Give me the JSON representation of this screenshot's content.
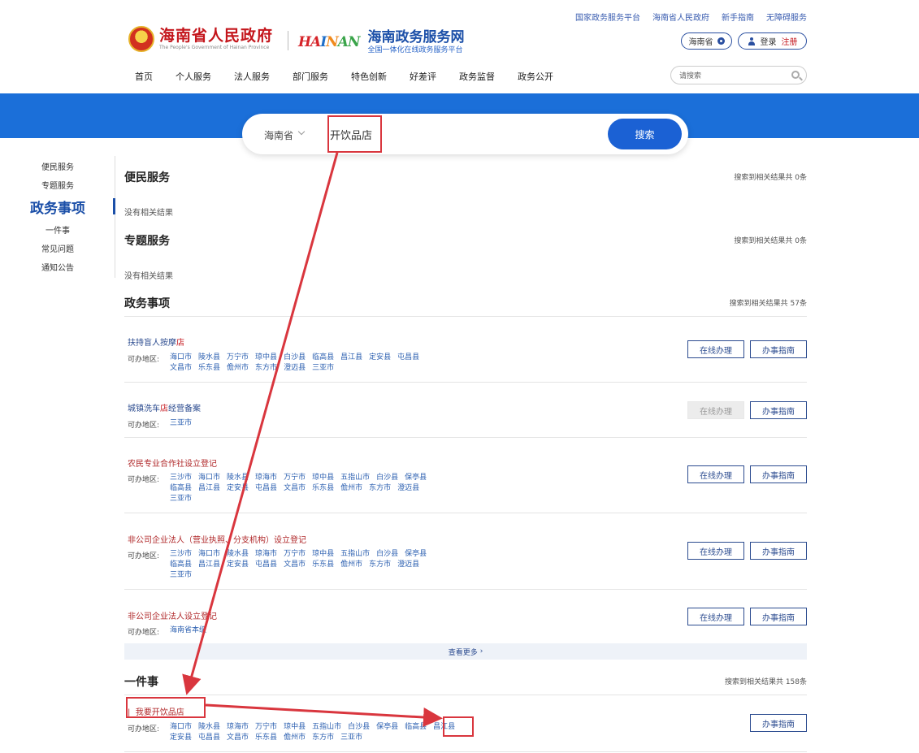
{
  "top_links": [
    "国家政务服务平台",
    "海南省人民政府",
    "新手指南",
    "无障碍服务"
  ],
  "logo_gov": {
    "zh": "海南省人民政府",
    "en": "The People's Government of Hainan Province"
  },
  "logo_service": {
    "brand": "HAINAN",
    "zh": "海南政务服务网",
    "sub": "全国一体化在线政务服务平台"
  },
  "region_selector": "海南省",
  "login": {
    "login_label": "登录",
    "register_label": "注册"
  },
  "nav": [
    "首页",
    "个人服务",
    "法人服务",
    "部门服务",
    "特色创新",
    "好差评",
    "政务监督",
    "政务公开"
  ],
  "site_search_placeholder": "请搜索",
  "main_search": {
    "region": "海南省",
    "query": "开饮品店",
    "button": "搜索"
  },
  "sidenav": [
    "便民服务",
    "专题服务",
    "政务事项",
    "一件事",
    "常见问题",
    "通知公告"
  ],
  "sections": {
    "bianmin": {
      "title": "便民服务",
      "count": "搜索到相关结果共 0条",
      "empty": "没有相关结果"
    },
    "zhuanti": {
      "title": "专题服务",
      "count": "搜索到相关结果共 0条",
      "empty": "没有相关结果"
    },
    "zhengwu": {
      "title": "政务事项",
      "count": "搜索到相关结果共 57条"
    },
    "yijianshi": {
      "title": "一件事",
      "count": "搜索到相关结果共 158条"
    }
  },
  "area_label": "可办地区:",
  "online_label": "在线办理",
  "guide_label": "办事指南",
  "more_label": "查看更多",
  "items": [
    {
      "name_pre": "扶持盲人按摩",
      "name_hl": "店",
      "name_post": "",
      "areas": [
        "海口市",
        "陵水县",
        "万宁市",
        "琼中县",
        "白沙县",
        "临高县",
        "昌江县",
        "定安县",
        "屯昌县",
        "文昌市",
        "乐东县",
        "儋州市",
        "东方市",
        "澄迈县",
        "三亚市"
      ]
    },
    {
      "name_pre": "城镇洗车",
      "name_hl": "店",
      "name_post": "经营备案",
      "areas": [
        "三亚市"
      ]
    },
    {
      "name_pre": "农民专业合作社设立登记",
      "name_hl": "",
      "name_post": "",
      "areas": [
        "三沙市",
        "海口市",
        "陵水县",
        "琼海市",
        "万宁市",
        "琼中县",
        "五指山市",
        "白沙县",
        "保亭县",
        "临高县",
        "昌江县",
        "定安县",
        "屯昌县",
        "文昌市",
        "乐东县",
        "儋州市",
        "东方市",
        "澄迈县",
        "三亚市"
      ]
    },
    {
      "name_pre": "非公司企业法人（营业执照、分支机构）设立登记",
      "name_hl": "",
      "name_post": "",
      "areas": [
        "三沙市",
        "海口市",
        "陵水县",
        "琼海市",
        "万宁市",
        "琼中县",
        "五指山市",
        "白沙县",
        "保亭县",
        "临高县",
        "昌江县",
        "定安县",
        "屯昌县",
        "文昌市",
        "乐东县",
        "儋州市",
        "东方市",
        "澄迈县",
        "三亚市"
      ]
    },
    {
      "name_pre": "非公司企业法人设立登记",
      "name_hl": "",
      "name_post": "",
      "areas": [
        "海南省本级"
      ]
    }
  ],
  "yijianshi_item": {
    "name": "我要开饮品店",
    "areas": [
      "海口市",
      "陵水县",
      "琼海市",
      "万宁市",
      "琼中县",
      "五指山市",
      "白沙县",
      "保亭县",
      "临高县",
      "昌江县",
      "定安县",
      "屯昌县",
      "文昌市",
      "乐东县",
      "儋州市",
      "东方市",
      "三亚市"
    ]
  },
  "colors": {
    "brand_blue": "#1b6fd9",
    "button_blue": "#1b61d4",
    "nav_blue": "#1b4fa8",
    "red": "#c4161c",
    "annotation_red": "#d9363e"
  }
}
